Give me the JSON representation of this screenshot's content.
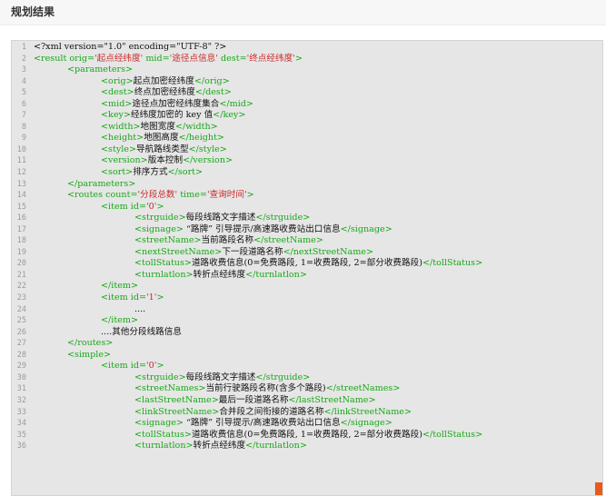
{
  "header": {
    "title": "规划结果"
  },
  "colors": {
    "tag": "#17a817",
    "value": "#cc2b2b",
    "text": "#111111",
    "line_number": "#9a9a9a",
    "panel_bg": "#e6e6e6",
    "corner_accent": "#e85a1a"
  },
  "code_lines": [
    {
      "n": "1",
      "indent": 0,
      "parts": [
        {
          "c": "txt",
          "t": "<?xml version=\"1.0\" encoding=\"UTF-8\" ?>"
        }
      ]
    },
    {
      "n": "2",
      "indent": 0,
      "parts": [
        {
          "c": "tag",
          "t": "<result "
        },
        {
          "c": "attr",
          "t": "orig="
        },
        {
          "c": "val",
          "t": "'起点经纬度'"
        },
        {
          "c": "attr",
          "t": " mid="
        },
        {
          "c": "val",
          "t": "'途径点信息'"
        },
        {
          "c": "attr",
          "t": " dest="
        },
        {
          "c": "val",
          "t": "'终点经纬度'"
        },
        {
          "c": "tag",
          "t": ">"
        }
      ]
    },
    {
      "n": "3",
      "indent": 1,
      "parts": [
        {
          "c": "tag",
          "t": "<parameters>"
        }
      ]
    },
    {
      "n": "4",
      "indent": 2,
      "parts": [
        {
          "c": "tag",
          "t": "<orig>"
        },
        {
          "c": "txt",
          "t": "起点加密经纬度"
        },
        {
          "c": "tag",
          "t": "</orig>"
        }
      ]
    },
    {
      "n": "5",
      "indent": 2,
      "parts": [
        {
          "c": "tag",
          "t": "<dest>"
        },
        {
          "c": "txt",
          "t": "终点加密经纬度"
        },
        {
          "c": "tag",
          "t": "</dest>"
        }
      ]
    },
    {
      "n": "6",
      "indent": 2,
      "parts": [
        {
          "c": "tag",
          "t": "<mid>"
        },
        {
          "c": "txt",
          "t": "途径点加密经纬度集合"
        },
        {
          "c": "tag",
          "t": "</mid>"
        }
      ]
    },
    {
      "n": "7",
      "indent": 2,
      "parts": [
        {
          "c": "tag",
          "t": "<key>"
        },
        {
          "c": "txt",
          "t": "经纬度加密的 key 值"
        },
        {
          "c": "tag",
          "t": "</key>"
        }
      ]
    },
    {
      "n": "8",
      "indent": 2,
      "parts": [
        {
          "c": "tag",
          "t": "<width>"
        },
        {
          "c": "txt",
          "t": "地图宽度"
        },
        {
          "c": "tag",
          "t": "</width>"
        }
      ]
    },
    {
      "n": "9",
      "indent": 2,
      "parts": [
        {
          "c": "tag",
          "t": "<height>"
        },
        {
          "c": "txt",
          "t": "地图高度"
        },
        {
          "c": "tag",
          "t": "</height>"
        }
      ]
    },
    {
      "n": "10",
      "indent": 2,
      "parts": [
        {
          "c": "tag",
          "t": "<style>"
        },
        {
          "c": "txt",
          "t": "导航路线类型"
        },
        {
          "c": "tag",
          "t": "</style>"
        }
      ]
    },
    {
      "n": "11",
      "indent": 2,
      "parts": [
        {
          "c": "tag",
          "t": "<version>"
        },
        {
          "c": "txt",
          "t": "版本控制"
        },
        {
          "c": "tag",
          "t": "</version>"
        }
      ]
    },
    {
      "n": "12",
      "indent": 2,
      "parts": [
        {
          "c": "tag",
          "t": "<sort>"
        },
        {
          "c": "txt",
          "t": "排序方式"
        },
        {
          "c": "tag",
          "t": "</sort>"
        }
      ]
    },
    {
      "n": "13",
      "indent": 1,
      "parts": [
        {
          "c": "tag",
          "t": "</parameters>"
        }
      ]
    },
    {
      "n": "14",
      "indent": 1,
      "parts": [
        {
          "c": "tag",
          "t": "<routes "
        },
        {
          "c": "attr",
          "t": "count="
        },
        {
          "c": "val",
          "t": "'分段总数'"
        },
        {
          "c": "attr",
          "t": " time="
        },
        {
          "c": "val",
          "t": "'查询时间'"
        },
        {
          "c": "tag",
          "t": ">"
        }
      ]
    },
    {
      "n": "15",
      "indent": 2,
      "parts": [
        {
          "c": "tag",
          "t": "<item "
        },
        {
          "c": "attr",
          "t": "id="
        },
        {
          "c": "val",
          "t": "'0'"
        },
        {
          "c": "tag",
          "t": ">"
        }
      ]
    },
    {
      "n": "16",
      "indent": 3,
      "parts": [
        {
          "c": "tag",
          "t": "<strguide>"
        },
        {
          "c": "txt",
          "t": "每段线路文字描述"
        },
        {
          "c": "tag",
          "t": "</strguide>"
        }
      ]
    },
    {
      "n": "17",
      "indent": 3,
      "parts": [
        {
          "c": "tag",
          "t": "<signage>"
        },
        {
          "c": "txt",
          "t": " “路牌” 引导提示/高速路收费站出口信息"
        },
        {
          "c": "tag",
          "t": "</signage>"
        }
      ]
    },
    {
      "n": "18",
      "indent": 3,
      "parts": [
        {
          "c": "tag",
          "t": "<streetName>"
        },
        {
          "c": "txt",
          "t": "当前路段名称"
        },
        {
          "c": "tag",
          "t": "</streetName>"
        }
      ]
    },
    {
      "n": "19",
      "indent": 3,
      "parts": [
        {
          "c": "tag",
          "t": "<nextStreetName>"
        },
        {
          "c": "txt",
          "t": "下一段道路名称"
        },
        {
          "c": "tag",
          "t": "</nextStreetName>"
        }
      ]
    },
    {
      "n": "20",
      "indent": 3,
      "parts": [
        {
          "c": "tag",
          "t": "<tollStatus>"
        },
        {
          "c": "txt",
          "t": "道路收费信息(0=免费路段, 1=收费路段, 2=部分收费路段)"
        },
        {
          "c": "tag",
          "t": "</tollStatus>"
        }
      ]
    },
    {
      "n": "21",
      "indent": 3,
      "parts": [
        {
          "c": "tag",
          "t": "<turnlatlon>"
        },
        {
          "c": "txt",
          "t": "转折点经纬度"
        },
        {
          "c": "tag",
          "t": "</turnlatlon>"
        }
      ]
    },
    {
      "n": "22",
      "indent": 2,
      "parts": [
        {
          "c": "tag",
          "t": "</item>"
        }
      ]
    },
    {
      "n": "23",
      "indent": 2,
      "parts": [
        {
          "c": "tag",
          "t": "<item "
        },
        {
          "c": "attr",
          "t": "id="
        },
        {
          "c": "val",
          "t": "'1'"
        },
        {
          "c": "tag",
          "t": ">"
        }
      ]
    },
    {
      "n": "24",
      "indent": 3,
      "parts": [
        {
          "c": "txt",
          "t": "...."
        }
      ]
    },
    {
      "n": "25",
      "indent": 2,
      "parts": [
        {
          "c": "tag",
          "t": "</item>"
        }
      ]
    },
    {
      "n": "26",
      "indent": 2,
      "parts": [
        {
          "c": "txt",
          "t": "....其他分段线路信息"
        }
      ]
    },
    {
      "n": "27",
      "indent": 1,
      "parts": [
        {
          "c": "tag",
          "t": "</routes>"
        }
      ]
    },
    {
      "n": "28",
      "indent": 1,
      "parts": [
        {
          "c": "tag",
          "t": "<simple>"
        }
      ]
    },
    {
      "n": "29",
      "indent": 2,
      "parts": [
        {
          "c": "tag",
          "t": "<item "
        },
        {
          "c": "attr",
          "t": "id="
        },
        {
          "c": "val",
          "t": "'0'"
        },
        {
          "c": "tag",
          "t": ">"
        }
      ]
    },
    {
      "n": "30",
      "indent": 3,
      "parts": [
        {
          "c": "tag",
          "t": "<strguide>"
        },
        {
          "c": "txt",
          "t": "每段线路文字描述"
        },
        {
          "c": "tag",
          "t": "</strguide>"
        }
      ]
    },
    {
      "n": "31",
      "indent": 3,
      "parts": [
        {
          "c": "tag",
          "t": "<streetNames>"
        },
        {
          "c": "txt",
          "t": "当前行驶路段名称(含多个路段)"
        },
        {
          "c": "tag",
          "t": "</streetNames>"
        }
      ]
    },
    {
      "n": "32",
      "indent": 3,
      "parts": [
        {
          "c": "tag",
          "t": "<lastStreetName>"
        },
        {
          "c": "txt",
          "t": "最后一段道路名称"
        },
        {
          "c": "tag",
          "t": "</lastStreetName>"
        }
      ]
    },
    {
      "n": "33",
      "indent": 3,
      "parts": [
        {
          "c": "tag",
          "t": "<linkStreetName>"
        },
        {
          "c": "txt",
          "t": "合并段之间衔接的道路名称"
        },
        {
          "c": "tag",
          "t": "</linkStreetName>"
        }
      ]
    },
    {
      "n": "34",
      "indent": 3,
      "parts": [
        {
          "c": "tag",
          "t": "<signage>"
        },
        {
          "c": "txt",
          "t": " “路牌” 引导提示/高速路收费站出口信息"
        },
        {
          "c": "tag",
          "t": "</signage>"
        }
      ]
    },
    {
      "n": "35",
      "indent": 3,
      "parts": [
        {
          "c": "tag",
          "t": "<tollStatus>"
        },
        {
          "c": "txt",
          "t": "道路收费信息(0=免费路段, 1=收费路段, 2=部分收费路段)"
        },
        {
          "c": "tag",
          "t": "</tollStatus>"
        }
      ]
    },
    {
      "n": "36",
      "indent": 3,
      "parts": [
        {
          "c": "tag",
          "t": "<turnlatlon>"
        },
        {
          "c": "txt",
          "t": "转折点经纬度"
        },
        {
          "c": "tag",
          "t": "</turnlatlon>"
        }
      ]
    }
  ]
}
